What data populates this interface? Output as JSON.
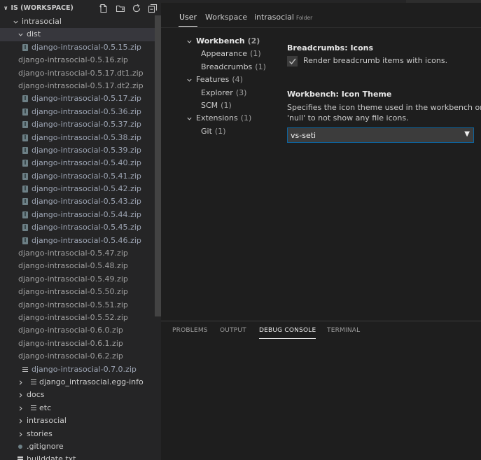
{
  "explorer": {
    "title": "IS (WORKSPACE)",
    "actions": [
      "new-file-icon",
      "new-folder-icon",
      "refresh-icon",
      "collapse-all-icon"
    ]
  },
  "tree": [
    {
      "label": "intrasocial",
      "kind": "folder-open",
      "depth": 1
    },
    {
      "label": "dist",
      "kind": "folder-open",
      "depth": 2,
      "selected": true
    },
    {
      "label": "django-intrasocial-0.5.15.zip",
      "kind": "zip",
      "depth": 3
    },
    {
      "label": "django-intrasocial-0.5.16.zip",
      "kind": "plain",
      "depth": 0
    },
    {
      "label": "django-intrasocial-0.5.17.dt1.zip",
      "kind": "plain",
      "depth": 0
    },
    {
      "label": "django-intrasocial-0.5.17.dt2.zip",
      "kind": "plain",
      "depth": 0
    },
    {
      "label": "django-intrasocial-0.5.17.zip",
      "kind": "zip",
      "depth": 3
    },
    {
      "label": "django-intrasocial-0.5.36.zip",
      "kind": "zip",
      "depth": 3
    },
    {
      "label": "django-intrasocial-0.5.37.zip",
      "kind": "zip",
      "depth": 3
    },
    {
      "label": "django-intrasocial-0.5.38.zip",
      "kind": "zip",
      "depth": 3
    },
    {
      "label": "django-intrasocial-0.5.39.zip",
      "kind": "zip",
      "depth": 3
    },
    {
      "label": "django-intrasocial-0.5.40.zip",
      "kind": "zip",
      "depth": 3
    },
    {
      "label": "django-intrasocial-0.5.41.zip",
      "kind": "zip",
      "depth": 3
    },
    {
      "label": "django-intrasocial-0.5.42.zip",
      "kind": "zip",
      "depth": 3
    },
    {
      "label": "django-intrasocial-0.5.43.zip",
      "kind": "zip",
      "depth": 3
    },
    {
      "label": "django-intrasocial-0.5.44.zip",
      "kind": "zip",
      "depth": 3
    },
    {
      "label": "django-intrasocial-0.5.45.zip",
      "kind": "zip",
      "depth": 3
    },
    {
      "label": "django-intrasocial-0.5.46.zip",
      "kind": "zip",
      "depth": 3
    },
    {
      "label": "django-intrasocial-0.5.47.zip",
      "kind": "plain",
      "depth": 0
    },
    {
      "label": "django-intrasocial-0.5.48.zip",
      "kind": "plain",
      "depth": 0
    },
    {
      "label": "django-intrasocial-0.5.49.zip",
      "kind": "plain",
      "depth": 0
    },
    {
      "label": "django-intrasocial-0.5.50.zip",
      "kind": "plain",
      "depth": 0
    },
    {
      "label": "django-intrasocial-0.5.51.zip",
      "kind": "plain",
      "depth": 0
    },
    {
      "label": "django-intrasocial-0.5.52.zip",
      "kind": "plain",
      "depth": 0
    },
    {
      "label": "django-intrasocial-0.6.0.zip",
      "kind": "plain",
      "depth": 0
    },
    {
      "label": "django-intrasocial-0.6.1.zip",
      "kind": "plain",
      "depth": 0
    },
    {
      "label": "django-intrasocial-0.6.2.zip",
      "kind": "plain",
      "depth": 0
    },
    {
      "label": "django-intrasocial-0.7.0.zip",
      "kind": "lines",
      "depth": 3
    },
    {
      "label": "django_intrasocial.egg-info",
      "kind": "folder-closed-icon",
      "depth": 2
    },
    {
      "label": "docs",
      "kind": "folder-closed",
      "depth": 2
    },
    {
      "label": "etc",
      "kind": "folder-closed-icon",
      "depth": 2
    },
    {
      "label": "intrasocial",
      "kind": "folder-closed",
      "depth": 2
    },
    {
      "label": "stories",
      "kind": "folder-closed",
      "depth": 2
    },
    {
      "label": ".gitignore",
      "kind": "dot",
      "depth": 2
    },
    {
      "label": "builddate.txt",
      "kind": "lines",
      "depth": 2
    }
  ],
  "settings": {
    "scope_tabs": [
      {
        "label": "User",
        "sub": ""
      },
      {
        "label": "Workspace",
        "sub": ""
      },
      {
        "label": "intrasocial",
        "sub": "Folder"
      }
    ],
    "toc": [
      {
        "label": "Workbench",
        "count": "(2)",
        "level": 0,
        "bold": true
      },
      {
        "label": "Appearance",
        "count": "(1)",
        "level": 1
      },
      {
        "label": "Breadcrumbs",
        "count": "(1)",
        "level": 1
      },
      {
        "label": "Features",
        "count": "(4)",
        "level": 0
      },
      {
        "label": "Explorer",
        "count": "(3)",
        "level": 1
      },
      {
        "label": "SCM",
        "count": "(1)",
        "level": 1
      },
      {
        "label": "Extensions",
        "count": "(1)",
        "level": 0
      },
      {
        "label": "Git",
        "count": "(1)",
        "level": 1
      }
    ],
    "breadcrumbs": {
      "category": "Breadcrumbs: ",
      "name": "Icons",
      "description": "Render breadcrumb items with icons.",
      "checked": true
    },
    "icon_theme": {
      "category": "Workbench: ",
      "name": "Icon Theme",
      "description": "Specifies the icon theme used in the workbench or 'null' to not show any file icons.",
      "value": "vs-seti"
    }
  },
  "panel": {
    "tabs": [
      "PROBLEMS",
      "OUTPUT",
      "DEBUG CONSOLE",
      "TERMINAL"
    ],
    "active": "DEBUG CONSOLE"
  },
  "colors": {
    "sidebar_bg": "#252526",
    "editor_bg": "#1e1e1e",
    "selection": "#37373d",
    "focus_border": "#0e639c"
  }
}
